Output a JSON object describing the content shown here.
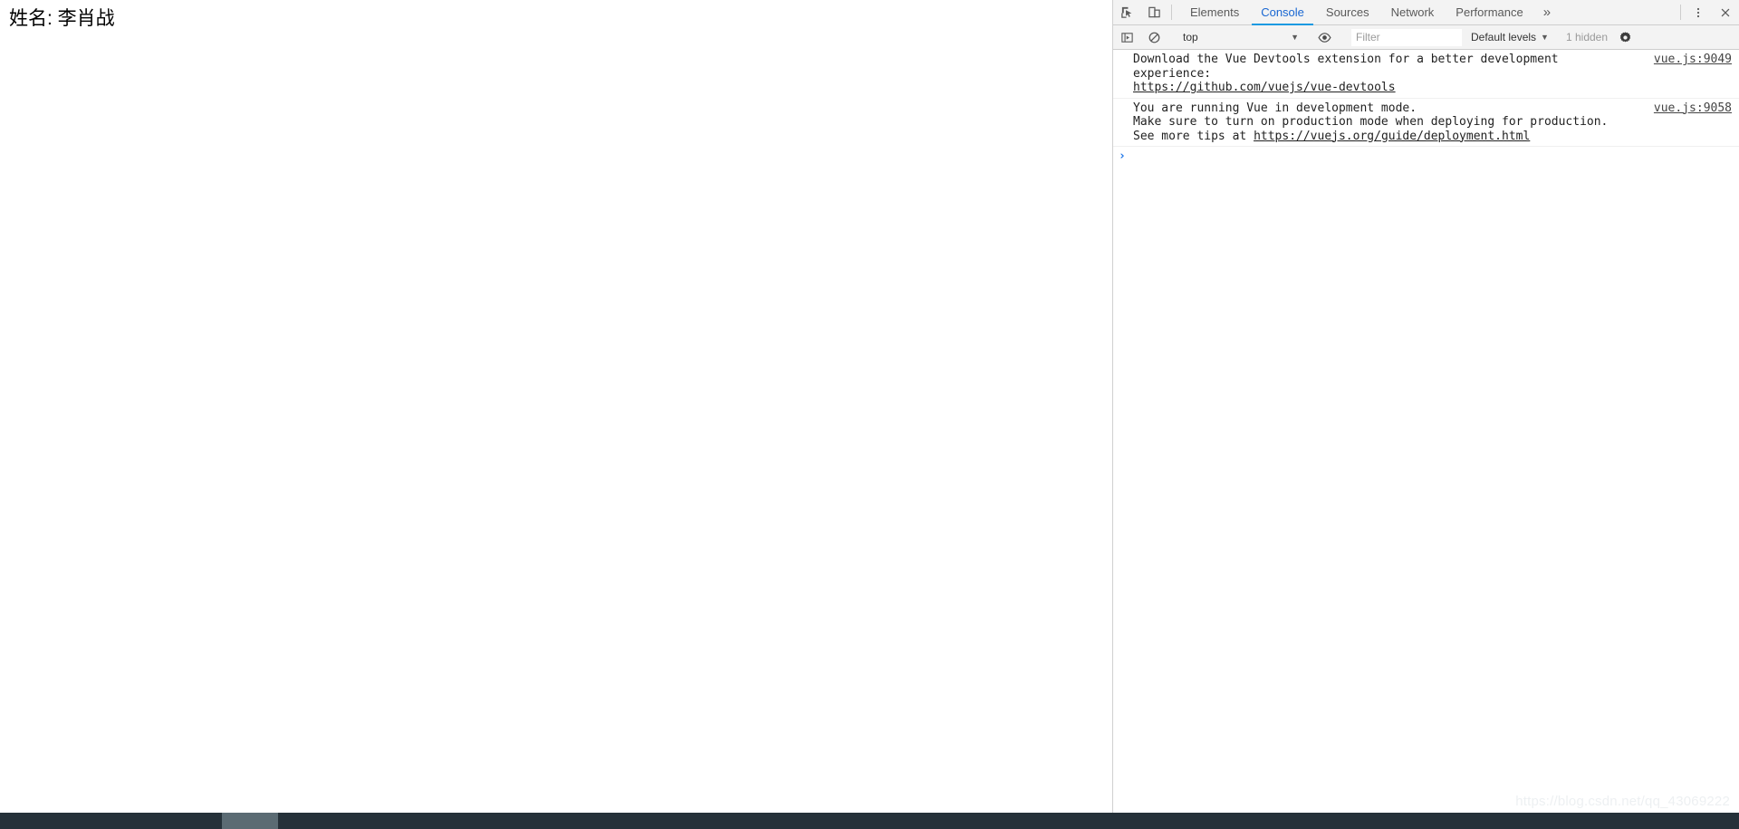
{
  "page": {
    "content_text": "姓名: 李肖战"
  },
  "devtools": {
    "tabs": [
      {
        "label": "Elements",
        "active": false
      },
      {
        "label": "Console",
        "active": true
      },
      {
        "label": "Sources",
        "active": false
      },
      {
        "label": "Network",
        "active": false
      },
      {
        "label": "Performance",
        "active": false
      }
    ],
    "more_tabs_glyph": "»",
    "icons": {
      "inspect": "inspect-element-icon",
      "device": "device-toolbar-icon",
      "kebab": "more-options-icon",
      "close": "close-devtools-icon",
      "sidebar": "console-sidebar-toggle-icon",
      "clear": "clear-console-icon",
      "eye": "create-live-expression-icon",
      "gear": "console-settings-icon"
    },
    "filterbar": {
      "context": "top",
      "context_caret": "▼",
      "filter_placeholder": "Filter",
      "filter_value": "",
      "levels_label": "Default levels",
      "levels_caret": "▼",
      "hidden_label": "1 hidden"
    },
    "console": {
      "messages": [
        {
          "lines": [
            {
              "text": "Download the Vue Devtools extension for a better development",
              "link": false
            },
            {
              "text": "experience:",
              "link": false
            },
            {
              "text": "https://github.com/vuejs/vue-devtools",
              "link": true
            }
          ],
          "source": "vue.js:9049"
        },
        {
          "lines": [
            {
              "text": "You are running Vue in development mode.",
              "link": false
            },
            {
              "text": "Make sure to turn on production mode when deploying for production.",
              "link": false
            },
            {
              "text": "See more tips at ",
              "link": false,
              "trailing_link": "https://vuejs.org/guide/deployment.html"
            }
          ],
          "source": "vue.js:9058"
        }
      ],
      "prompt_chevron": "›",
      "prompt_value": ""
    }
  },
  "watermark": {
    "text": "https://blog.csdn.net/qq_43069222"
  },
  "colors": {
    "accent": "#1a9ae1",
    "tab_active_text": "#1967d2",
    "toolbar_bg": "#f3f3f3",
    "prompt_blue": "#1a73e8",
    "bottom_bar": "#253139",
    "scroll_thumb": "#5b6b73"
  }
}
